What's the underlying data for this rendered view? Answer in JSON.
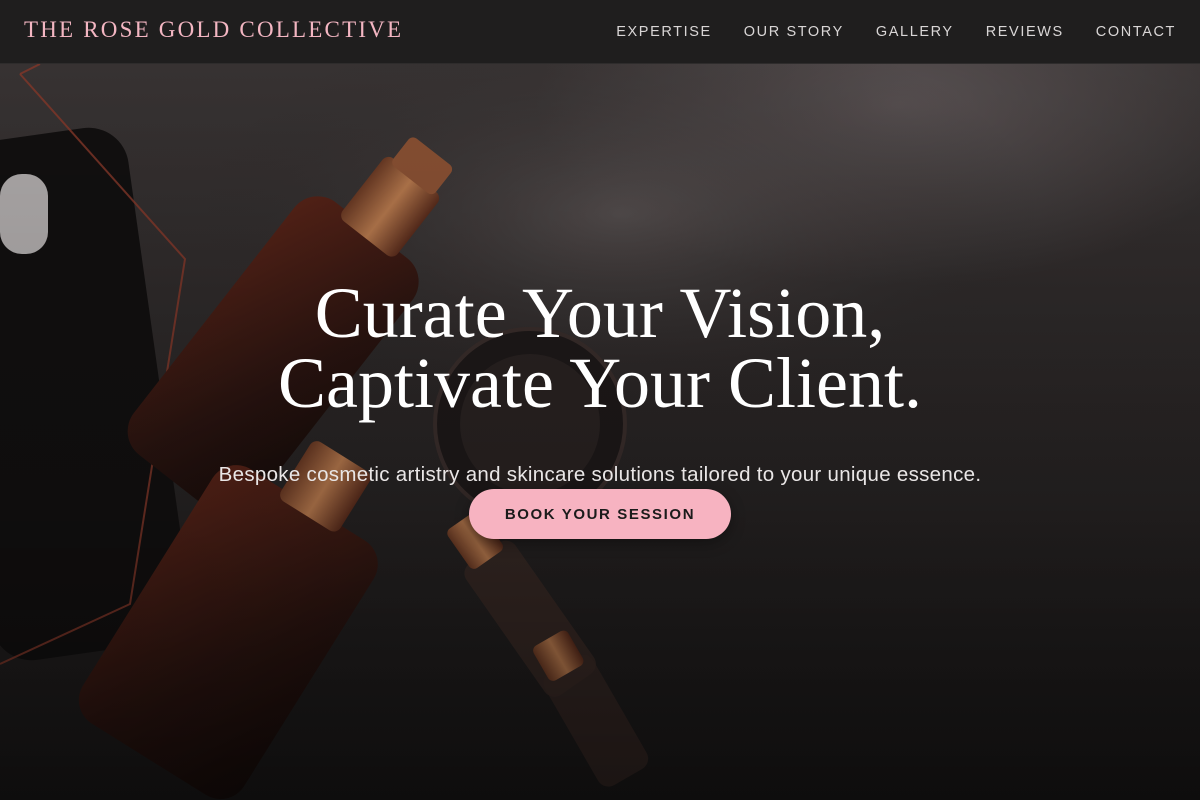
{
  "header": {
    "brand": "THE ROSE GOLD COLLECTIVE",
    "nav": [
      {
        "label": "EXPERTISE"
      },
      {
        "label": "OUR STORY"
      },
      {
        "label": "GALLERY"
      },
      {
        "label": "REVIEWS"
      },
      {
        "label": "CONTACT"
      }
    ]
  },
  "hero": {
    "headline_line1": "Curate Your Vision,",
    "headline_line2": "Captivate Your Client.",
    "subheadline": "Bespoke cosmetic artistry and skincare solutions tailored to your unique essence.",
    "cta_label": "BOOK YOUR SESSION",
    "image_subject": "cosmetic-bottles-background"
  },
  "colors": {
    "brand_pink": "#f3b6c2",
    "cta_background": "#f7b3c1",
    "header_background": "#1f1e1e",
    "text_light": "#ffffff"
  }
}
